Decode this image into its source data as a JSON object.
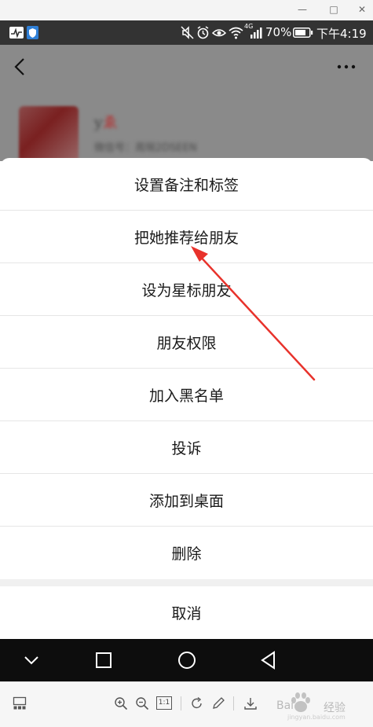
{
  "window": {
    "minimize_glyph": "—",
    "maximize_glyph": "□",
    "close_glyph": "✕"
  },
  "status_bar": {
    "left_icons": [
      "activity-app-icon",
      "shield-app-icon"
    ],
    "right_icons": [
      "mute-icon",
      "alarm-icon",
      "eye-icon",
      "wifi-icon",
      "signal-4g-icon",
      "battery-icon"
    ],
    "network_label": "4G",
    "battery": "70%",
    "time": "下午4:19"
  },
  "background_profile": {
    "name": "y",
    "name_suffix": "ゑ",
    "id_line": "微信号：周琬2DSEEN"
  },
  "action_sheet": {
    "items": [
      {
        "label": "设置备注和标签"
      },
      {
        "label": "把她推荐给朋友"
      },
      {
        "label": "设为星标朋友"
      },
      {
        "label": "朋友权限"
      },
      {
        "label": "加入黑名单"
      },
      {
        "label": "投诉"
      },
      {
        "label": "添加到桌面"
      },
      {
        "label": "删除"
      }
    ],
    "cancel": "取消"
  },
  "annotation": {
    "color": "#e8322b"
  },
  "viewer_toolbar": {
    "zoom_label": "1:1",
    "watermark_text": "Bai",
    "watermark_text2": "经验",
    "watermark_sub": "jingyan.baidu.com"
  },
  "colors": {
    "status_bar_bg": "#333333",
    "nav_bar_bg": "#0d0d0d",
    "sheet_bg": "#ffffff",
    "overlay_bg": "#8a8a8a"
  }
}
